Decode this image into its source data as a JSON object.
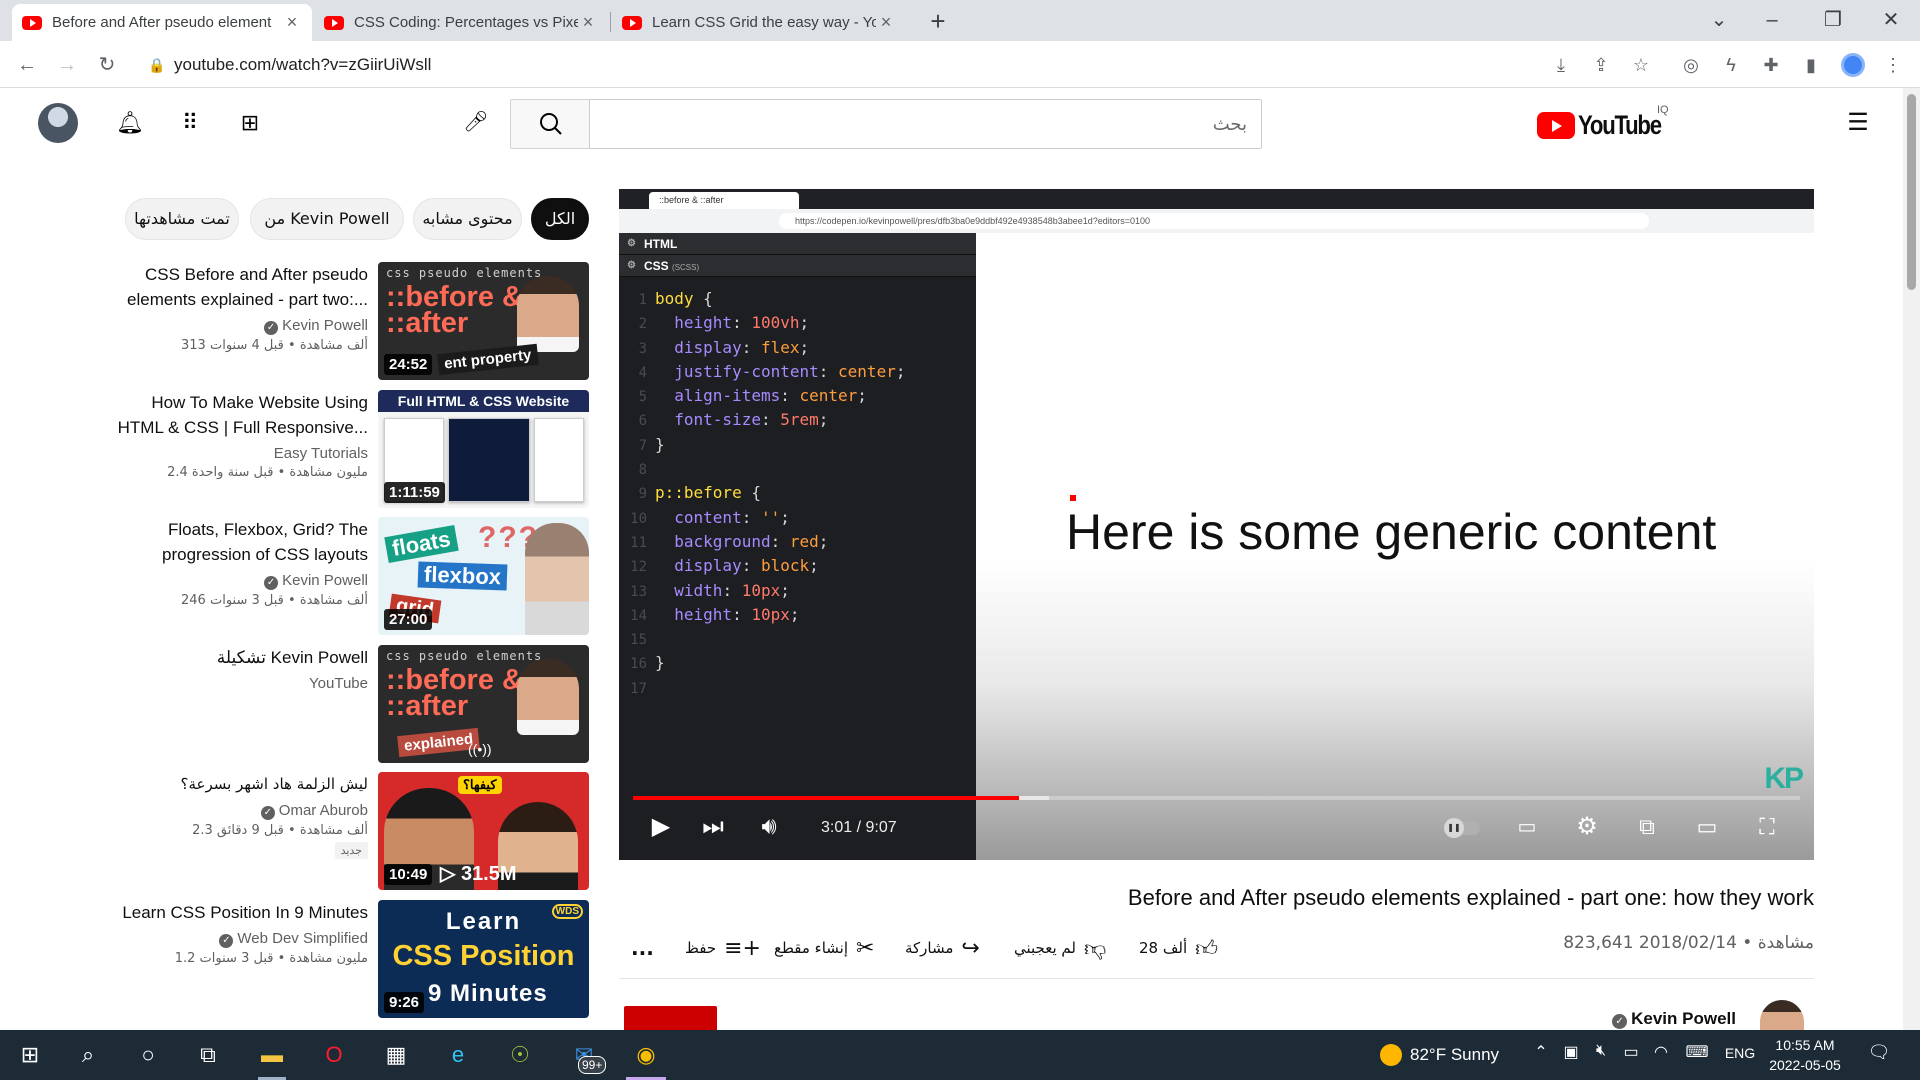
{
  "browser": {
    "tabs": [
      {
        "title": "Before and After pseudo element",
        "active": true
      },
      {
        "title": "CSS Coding: Percentages vs Pixel",
        "active": false
      },
      {
        "title": "Learn CSS Grid the easy way - Yo",
        "active": false
      }
    ],
    "new_tab_icon": "+",
    "url": "youtube.com/watch?v=zGiirUiWsll"
  },
  "header": {
    "search_placeholder": "بحث",
    "logo_text": "YouTube",
    "country_code": "IQ"
  },
  "chips": [
    "الكل",
    "محتوى مشابه",
    "من Kevin Powell",
    "تمت مشاهدتها"
  ],
  "recommendations": [
    {
      "title_line1": "CSS Before and After pseudo",
      "title_line2": "elements explained - part two:...",
      "channel": "Kevin Powell",
      "verified": true,
      "stats": "313 ألف مشاهدة • قبل 4 سنوات",
      "duration": "24:52",
      "thumb_text": {
        "label": "css pseudo elements",
        "big": "::before & ::after",
        "strip": "ent property"
      }
    },
    {
      "title_line1": "How To Make Website Using",
      "title_line2": "HTML & CSS | Full Responsive...",
      "channel": "Easy Tutorials",
      "verified": false,
      "stats": "2.4 مليون مشاهدة • قبل سنة واحدة",
      "duration": "1:11:59",
      "thumb_text": {
        "band": "Full HTML & CSS Website"
      }
    },
    {
      "title_line1": "Floats, Flexbox, Grid? The",
      "title_line2": "progression of CSS layouts",
      "channel": "Kevin Powell",
      "verified": true,
      "stats": "246 ألف مشاهدة • قبل 3 سنوات",
      "duration": "27:00",
      "thumb_text": {
        "w1": "floats",
        "w2": "flexbox",
        "w3": "grid",
        "q": "???"
      }
    },
    {
      "title_line1": "تشكيلة Kevin Powell",
      "title_line2": "",
      "channel": "YouTube",
      "verified": false,
      "stats": "",
      "duration": "",
      "thumb_text": {
        "label": "css pseudo elements",
        "big": "::before & ::after",
        "strip": "explained"
      }
    },
    {
      "title_line1": "ليش الزلمة هاد اشهر بسرعة؟",
      "title_line2": "",
      "channel": "Omar Aburob",
      "verified": true,
      "stats": "2.3 ألف مشاهدة • قبل 9 دقائق",
      "badge": "جديد",
      "duration": "10:49",
      "thumb_text": {
        "tag": "كيفها؟",
        "views": "▷ 31.5M"
      }
    },
    {
      "title_line1": "Learn CSS Position In 9 Minutes",
      "title_line2": "",
      "channel": "Web Dev Simplified",
      "verified": true,
      "stats": "1.2 مليون مشاهدة • قبل 3 سنوات",
      "duration": "9:26",
      "thumb_text": {
        "l1": "Learn",
        "l2": "CSS Position",
        "l3": "9 Minutes",
        "wds": "WDS"
      }
    }
  ],
  "player": {
    "inner_tab_title": "::before & ::after",
    "inner_url": "https://codepen.io/kevinpowell/pres/dfb3ba0e9ddbf492e4938548b3abee1d?editors=0100",
    "html_panel_label": "HTML",
    "css_panel_label": "CSS",
    "css_panel_sub": "(SCSS)",
    "code_lines": [
      "body {",
      "  height: 100vh;",
      "  display: flex;",
      "  justify-content: center;",
      "  align-items: center;",
      "  font-size: 5rem;",
      "}",
      "",
      "p::before {",
      "  content: '';",
      "  background: red;",
      "  display: block;",
      "  width: 10px;",
      "  height: 10px;",
      "",
      "}",
      ""
    ],
    "preview_text": "Here is some generic content",
    "watermark": "KP",
    "current_time": "3:01",
    "duration": "9:07",
    "time_display": "3:01 / 9:07",
    "progress_played": 0.3311,
    "progress_buffered": 0.3567
  },
  "video": {
    "title": "Before and After pseudo elements explained - part one: how they work",
    "views_date": "823,641 مشاهدة • 2018/02/14",
    "likes": "28 ألف",
    "dislike_label": "لم يعجبني",
    "share_label": "مشاركة",
    "clip_label": "إنشاء مقطع",
    "save_label": "حفظ",
    "more_label": "...",
    "channel": "Kevin Powell"
  },
  "taskbar": {
    "weather": "82°F  Sunny",
    "lang": "ENG",
    "time": "10:55 AM",
    "date": "2022-05-05",
    "mail_badge": "99+"
  },
  "colors": {
    "youtube_red": "#ff0000",
    "taskbar": "#1c2b36",
    "chip_active": "#0f0f0f",
    "code_bg": "#1d1e22"
  }
}
